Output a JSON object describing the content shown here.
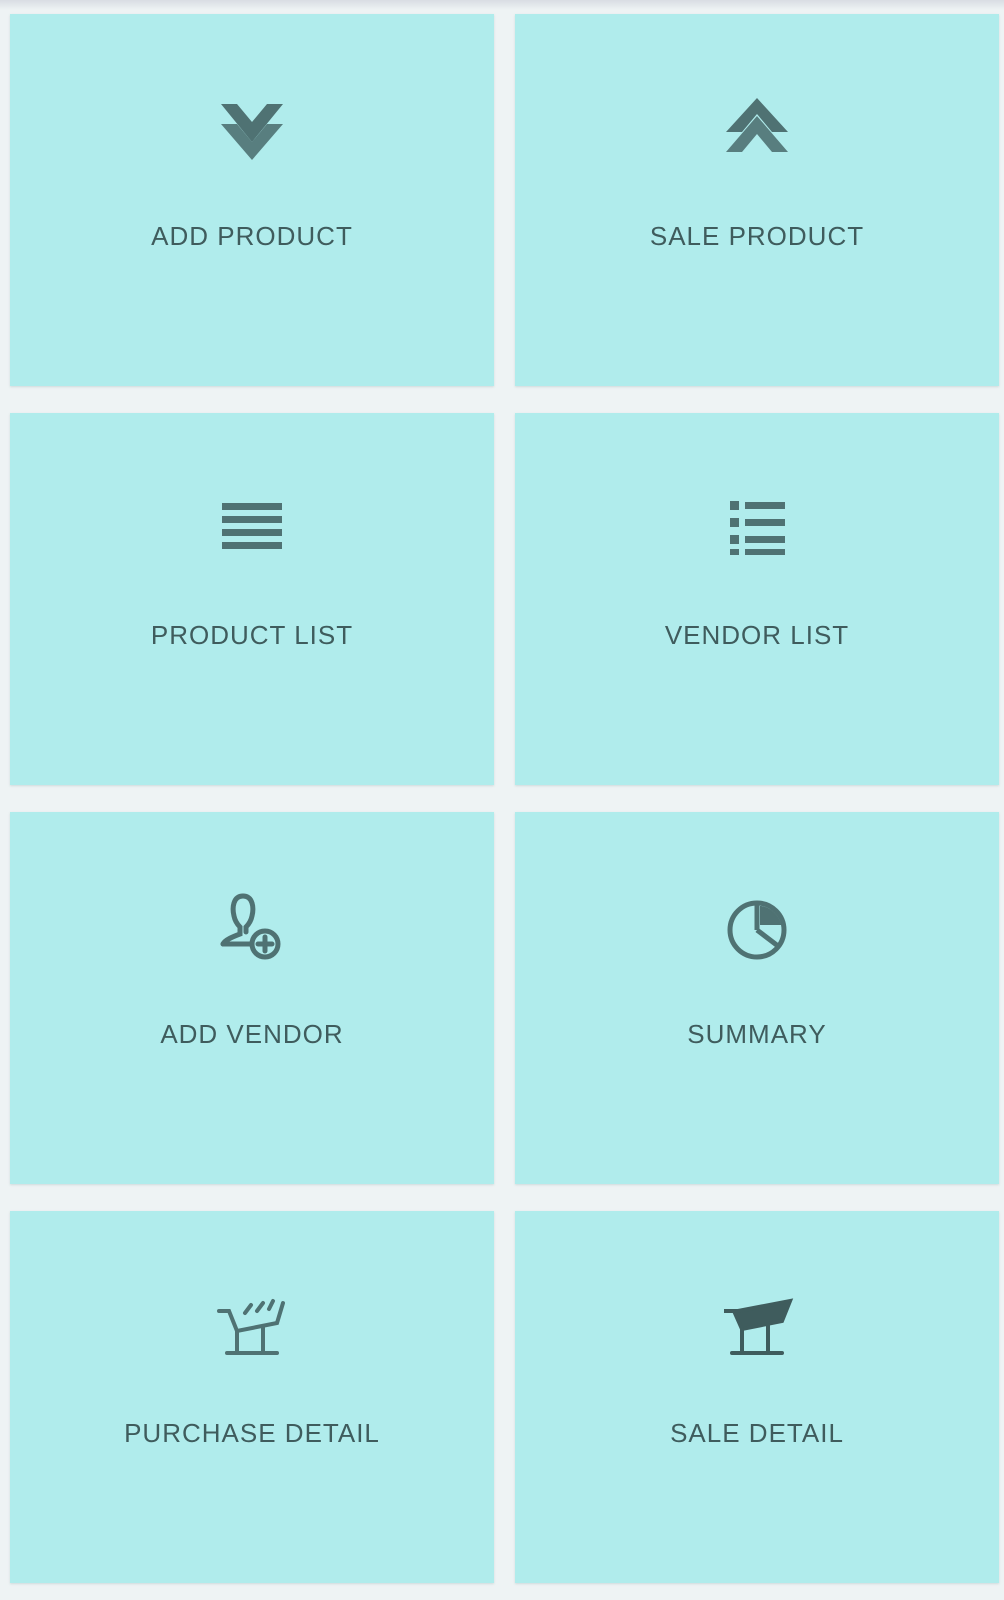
{
  "colors": {
    "tile_background": "#b0ecec",
    "page_background": "#eef3f4",
    "icon_color": "#4f7273",
    "label_color": "#3f5c5d"
  },
  "tiles": [
    {
      "label": "ADD PRODUCT",
      "icon": "double-chevron-down-icon"
    },
    {
      "label": "SALE PRODUCT",
      "icon": "double-chevron-up-icon"
    },
    {
      "label": "PRODUCT LIST",
      "icon": "menu-lines-icon"
    },
    {
      "label": "VENDOR LIST",
      "icon": "bulleted-list-icon"
    },
    {
      "label": "ADD VENDOR",
      "icon": "add-user-icon"
    },
    {
      "label": "SUMMARY",
      "icon": "pie-chart-icon"
    },
    {
      "label": "PURCHASE DETAIL",
      "icon": "shopping-cart-icon"
    },
    {
      "label": "SALE DETAIL",
      "icon": "shopping-cart-filled-icon"
    }
  ]
}
